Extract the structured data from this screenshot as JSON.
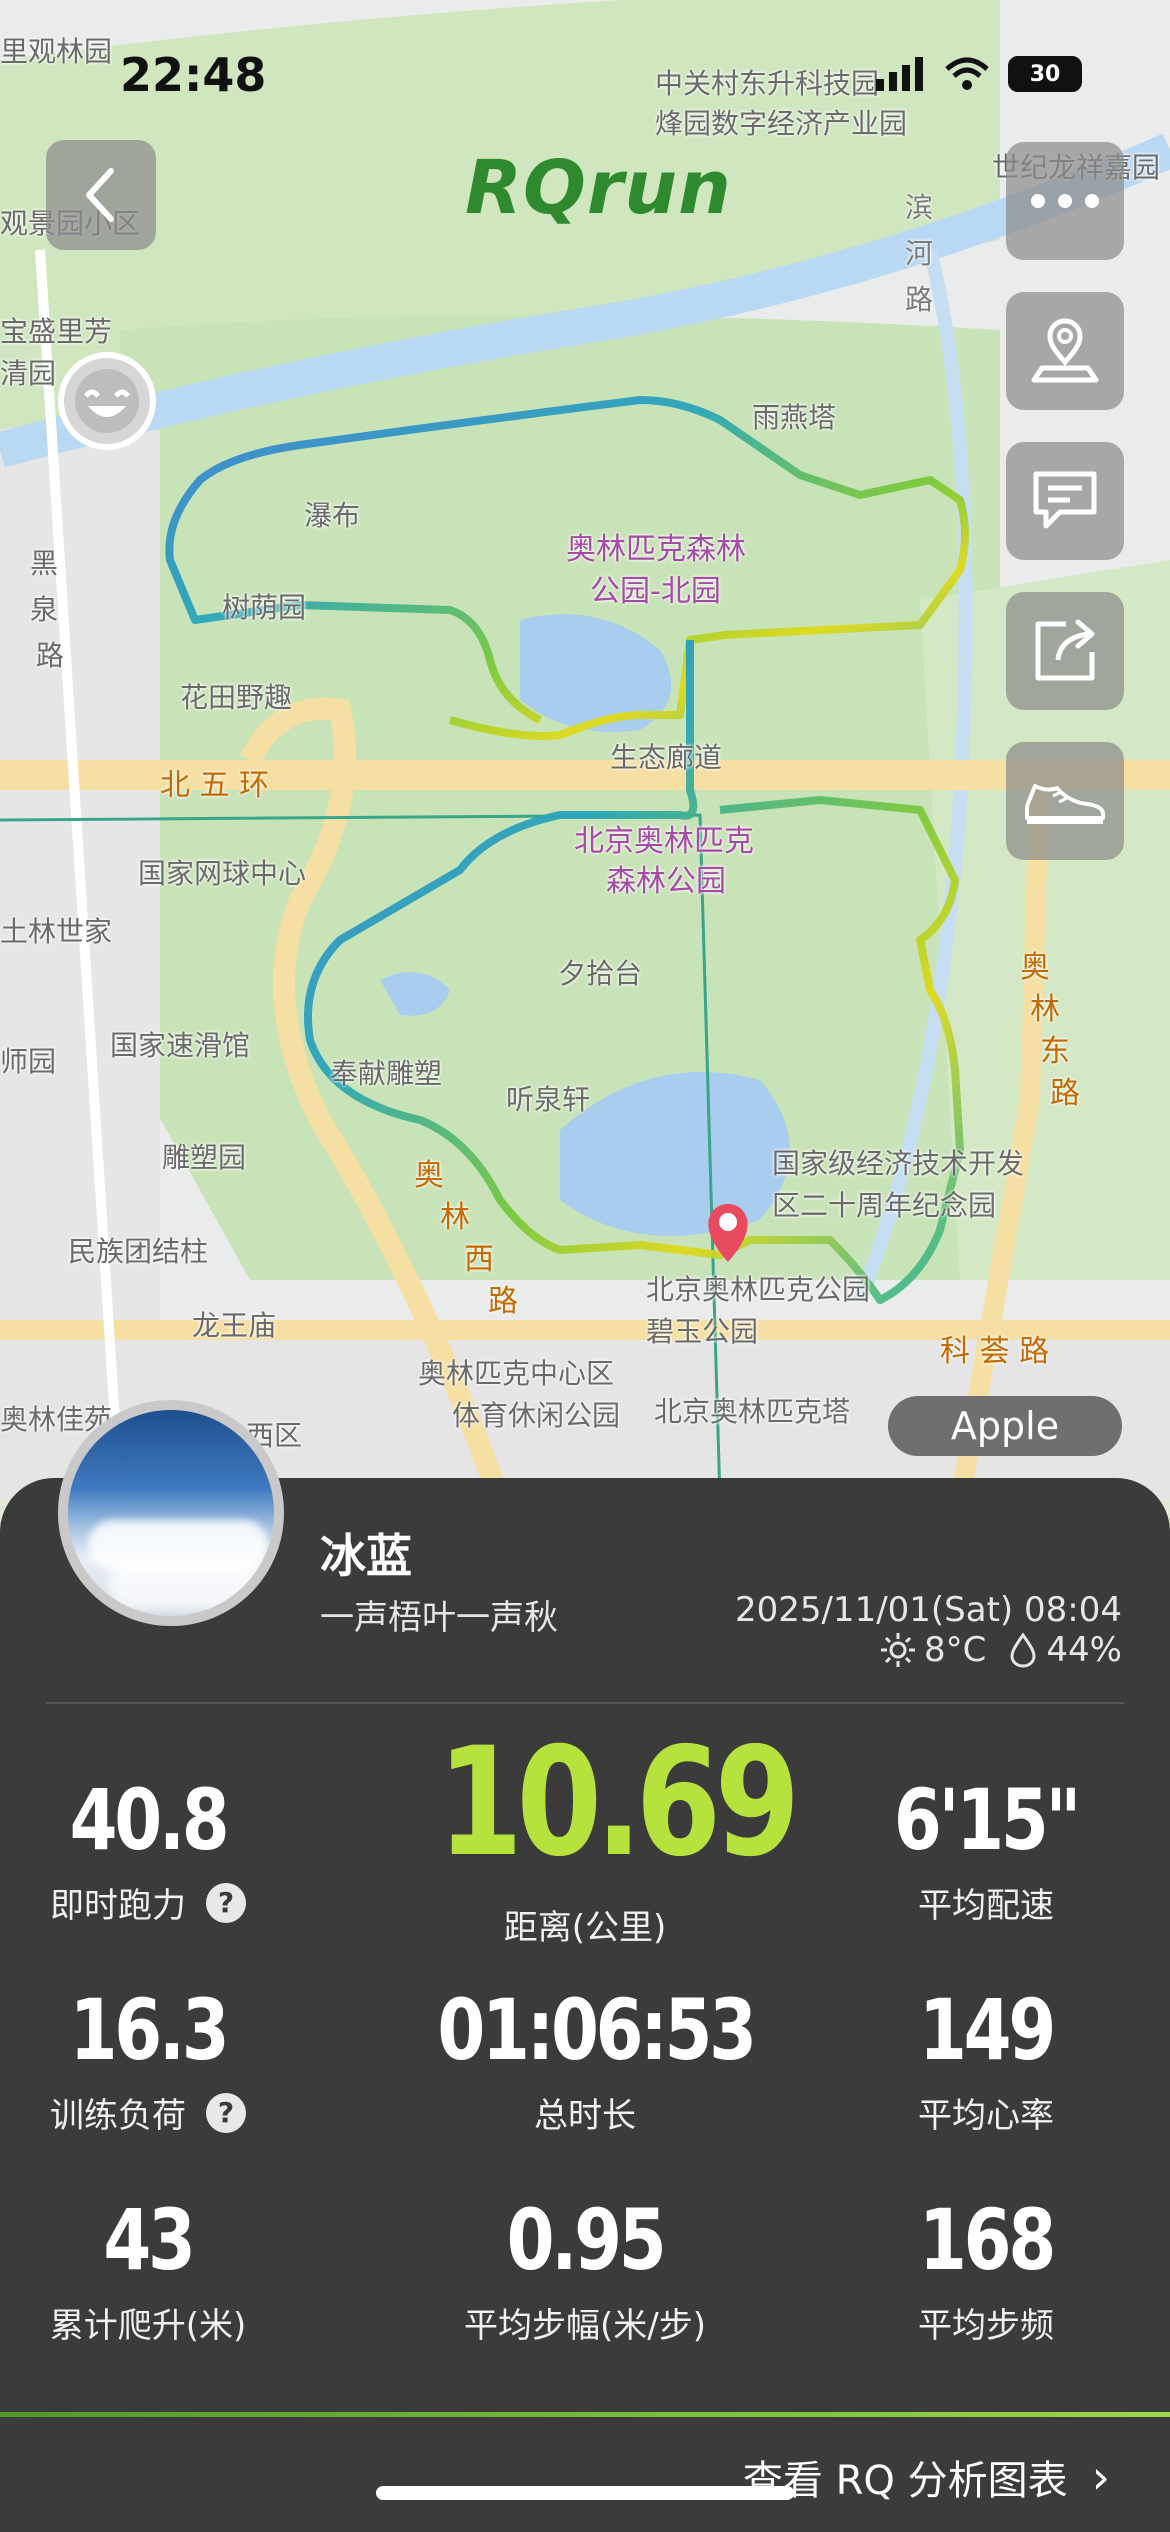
{
  "status_bar": {
    "time": "22:48",
    "battery": "30"
  },
  "app": {
    "brand": "RQrun"
  },
  "map": {
    "labels": [
      "里观林园",
      "中关村东升科技园",
      "烽园数字经济产业园",
      "世纪龙祥嘉园",
      "观景园小区",
      "宝盛里芳",
      "清园",
      "滨",
      "河",
      "路",
      "雨燕塔",
      "瀑布",
      "奥林匹克森林",
      "公园-北园",
      "黑",
      "泉",
      "路",
      "树荫园",
      "花田野趣",
      "北 五 环",
      "生态廊道",
      "国家网球中心",
      "北京奥林匹克",
      "森林公园",
      "土林世家",
      "夕拾台",
      "奥",
      "林",
      "东",
      "路",
      "国家速滑馆",
      "师园",
      "奉献雕塑",
      "听泉轩",
      "雕塑园",
      "国家级经济技术开发",
      "区二十周年纪念园",
      "奥",
      "林",
      "西",
      "路",
      "民族团结柱",
      "北京奥林匹克公园",
      "碧玉公园",
      "龙王庙",
      "科 荟 路",
      "奥林匹克中心区",
      "体育休闲公园",
      "北京奥林匹克塔",
      "奥林佳苑",
      "西区"
    ],
    "provider_badge": "Apple"
  },
  "profile": {
    "name": "冰蓝",
    "signature": "一声梧叶一声秋",
    "date": "2025/11/01(Sat) 08:04",
    "temperature": "8°C",
    "humidity": "44%"
  },
  "stats": [
    {
      "value": "40.8",
      "label": "即时跑力",
      "help": "?"
    },
    {
      "value": "10.69",
      "label": "距离(公里)"
    },
    {
      "value": "6'15\"",
      "label": "平均配速"
    },
    {
      "value": "16.3",
      "label": "训练负荷",
      "help": "?"
    },
    {
      "value": "01:06:53",
      "label": "总时长"
    },
    {
      "value": "149",
      "label": "平均心率"
    },
    {
      "value": "43",
      "label": "累计爬升(米)"
    },
    {
      "value": "0.95",
      "label": "平均步幅(米/步)"
    },
    {
      "value": "168",
      "label": "平均步频"
    }
  ],
  "footer": {
    "analysis_link": "查看 RQ 分析图表",
    "chevron": "›"
  },
  "colors": {
    "distance_accent": "#b5e23c",
    "panel_bg": "#3b3b3b",
    "brand": "#2f8a2f"
  }
}
